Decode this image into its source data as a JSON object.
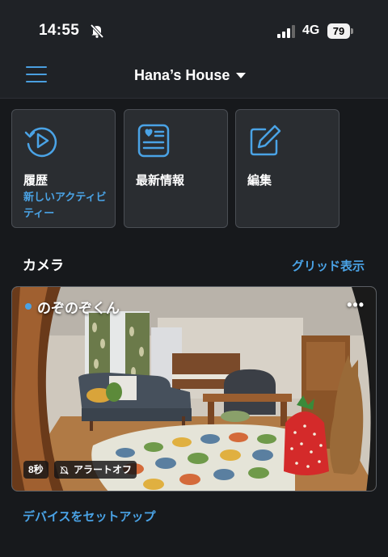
{
  "status_bar": {
    "time": "14:55",
    "network": "4G",
    "battery": "79"
  },
  "header": {
    "home_name": "Hana’s House"
  },
  "actions": [
    {
      "label": "履歴",
      "sub": "新しいアクティビティー"
    },
    {
      "label": "最新情報",
      "sub": ""
    },
    {
      "label": "編集",
      "sub": ""
    }
  ],
  "cameras": {
    "title": "カメラ",
    "grid_link": "グリッド表示",
    "items": [
      {
        "name": "のぞのぞくん",
        "duration": "8秒",
        "alert_status": "アラートオフ",
        "more": "•••"
      }
    ]
  },
  "setup_link": "デバイスをセットアップ",
  "colors": {
    "accent": "#4aa3e6",
    "background": "#17191c",
    "card": "#2a2d31"
  }
}
